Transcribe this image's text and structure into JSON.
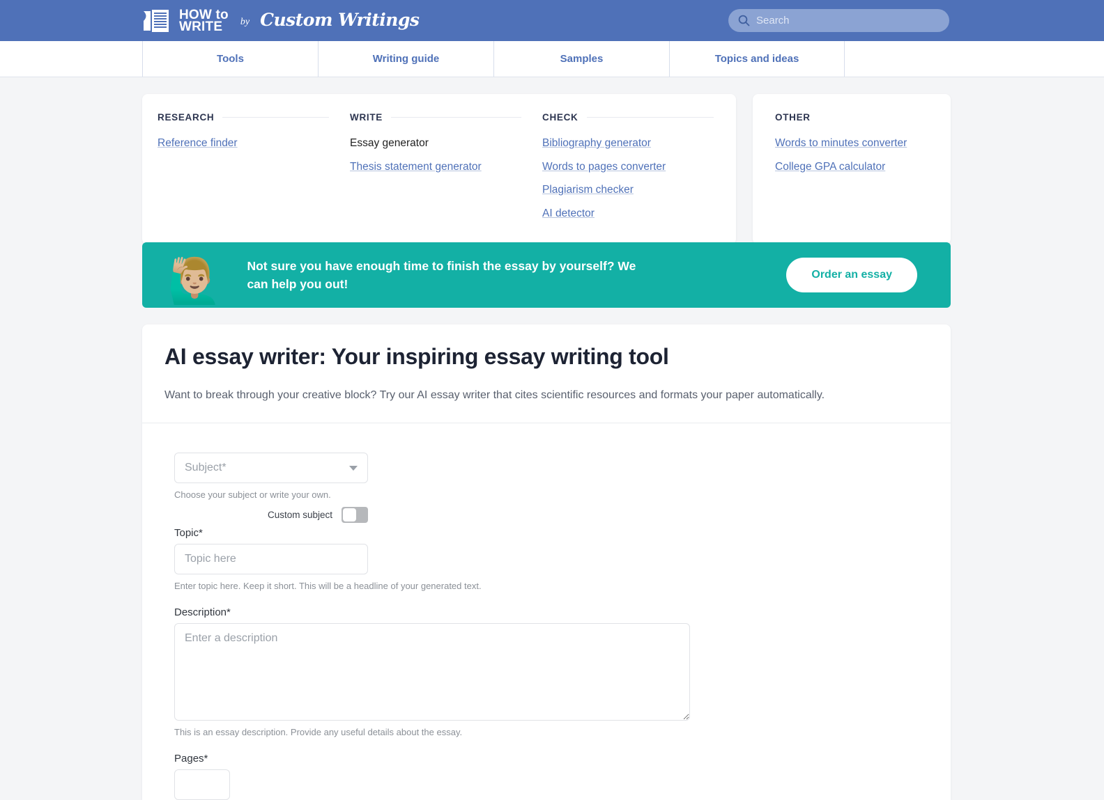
{
  "header": {
    "logo": {
      "line1": "HOW to",
      "line2": "WRITE",
      "by": "by",
      "brand": "Custom Writings",
      "icon": "document-lines-icon"
    },
    "search": {
      "placeholder": "Search",
      "value": "",
      "icon": "search-icon"
    }
  },
  "nav": {
    "tabs": [
      {
        "label": "Tools"
      },
      {
        "label": "Writing guide"
      },
      {
        "label": "Samples"
      },
      {
        "label": "Topics and ideas"
      }
    ]
  },
  "tools": {
    "columns": [
      {
        "title": "RESEARCH",
        "links": [
          {
            "label": "Reference finder",
            "current": false
          }
        ]
      },
      {
        "title": "WRITE",
        "links": [
          {
            "label": "Essay generator",
            "current": true
          },
          {
            "label": "Thesis statement generator",
            "current": false
          }
        ]
      },
      {
        "title": "CHECK",
        "links": [
          {
            "label": "Bibliography generator",
            "current": false
          },
          {
            "label": "Words to pages converter",
            "current": false
          },
          {
            "label": "Plagiarism checker",
            "current": false
          },
          {
            "label": "AI detector",
            "current": false
          }
        ]
      }
    ],
    "other": {
      "title": "OTHER",
      "links": [
        {
          "label": "Words to minutes converter",
          "current": false
        },
        {
          "label": "College GPA calculator",
          "current": false
        }
      ]
    }
  },
  "promo": {
    "emoji": "🙋🏼‍♂️",
    "emoji_name": "person-raising-hand-emoji",
    "text": "Not sure you have enough time to finish the essay by yourself? We can help you out!",
    "button_label": "Order an essay",
    "background_color": "#13b0a5",
    "button_text_color": "#13b0a5"
  },
  "main": {
    "title": "AI essay writer: Your inspiring essay writing tool",
    "subtitle": "Want to break through your creative block? Try our AI essay writer that cites scientific resources and formats your paper automatically."
  },
  "form": {
    "subject": {
      "placeholder": "Subject*",
      "value": "",
      "hint": "Choose your subject or write your own.",
      "caret_icon": "chevron-down-icon"
    },
    "custom_subject": {
      "label": "Custom subject",
      "state": "off"
    },
    "topic": {
      "label": "Topic*",
      "placeholder": "Topic here",
      "value": "",
      "hint": "Enter topic here. Keep it short. This will be a headline of your generated text."
    },
    "description": {
      "label": "Description*",
      "placeholder": "Enter a description",
      "value": "",
      "hint": "This is an essay description. Provide any useful details about the essay."
    },
    "pages": {
      "label": "Pages*",
      "value": ""
    }
  },
  "colors": {
    "header_blue": "#4f71b8",
    "link_blue": "#4f71b8",
    "teal": "#13b0a5",
    "page_bg": "#f4f5f7"
  }
}
